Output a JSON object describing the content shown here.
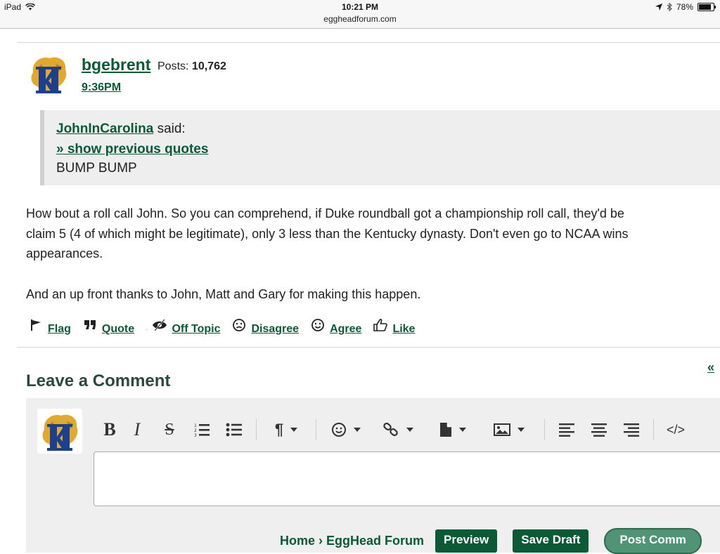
{
  "status_bar": {
    "device": "iPad",
    "time": "10:21 PM",
    "url": "eggheadforum.com",
    "battery": "78%",
    "battery_level": 0.78
  },
  "post": {
    "username": "bgebrent",
    "posts_label": "Posts:",
    "posts_count": "10,762",
    "time": "9:36PM",
    "quote": {
      "author": "JohnInCarolina",
      "said": "said:",
      "show_previous": "» show previous quotes",
      "text": "BUMP BUMP"
    },
    "body": {
      "line1": "How bout a roll call John.  So you can comprehend, if Duke roundball got a championship roll call, they'd be",
      "line2": "claim 5 (4 of which might be legitimate), only 3 less than the Kentucky dynasty.  Don't even go to NCAA wins",
      "line3": "appearances.",
      "line4": "And an up front thanks to John, Matt and Gary for making this happen."
    },
    "actions": {
      "flag": "Flag",
      "quote": "Quote",
      "off_topic": "Off Topic",
      "disagree": "Disagree",
      "agree": "Agree",
      "like": "Like"
    }
  },
  "comment": {
    "collapse": "«",
    "heading": "Leave a Comment",
    "toolbar": {
      "bold": "B",
      "italic": "I",
      "strike": "S",
      "paragraph": "¶",
      "code": "</>"
    },
    "breadcrumb": "Home › EggHead Forum",
    "preview": "Preview",
    "save_draft": "Save Draft",
    "post_comment": "Post Comm"
  },
  "colors": {
    "accent": "#0b5a36",
    "heading": "#2b4a3c",
    "editor_bg": "#efefef",
    "quote_bg": "#eeeeee"
  }
}
